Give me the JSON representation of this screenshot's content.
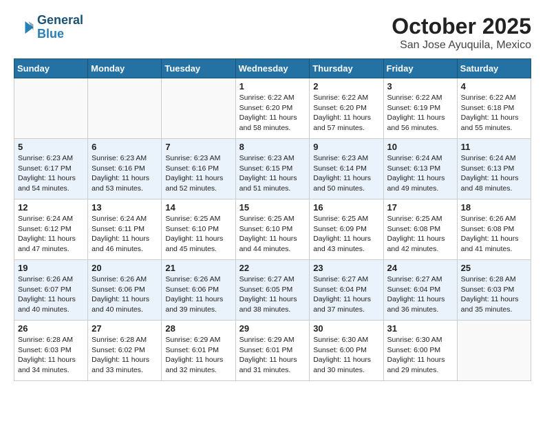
{
  "header": {
    "logo_line1": "General",
    "logo_line2": "Blue",
    "month": "October 2025",
    "location": "San Jose Ayuquila, Mexico"
  },
  "weekdays": [
    "Sunday",
    "Monday",
    "Tuesday",
    "Wednesday",
    "Thursday",
    "Friday",
    "Saturday"
  ],
  "weeks": [
    [
      {
        "day": "",
        "info": ""
      },
      {
        "day": "",
        "info": ""
      },
      {
        "day": "",
        "info": ""
      },
      {
        "day": "1",
        "info": "Sunrise: 6:22 AM\nSunset: 6:20 PM\nDaylight: 11 hours\nand 58 minutes."
      },
      {
        "day": "2",
        "info": "Sunrise: 6:22 AM\nSunset: 6:20 PM\nDaylight: 11 hours\nand 57 minutes."
      },
      {
        "day": "3",
        "info": "Sunrise: 6:22 AM\nSunset: 6:19 PM\nDaylight: 11 hours\nand 56 minutes."
      },
      {
        "day": "4",
        "info": "Sunrise: 6:22 AM\nSunset: 6:18 PM\nDaylight: 11 hours\nand 55 minutes."
      }
    ],
    [
      {
        "day": "5",
        "info": "Sunrise: 6:23 AM\nSunset: 6:17 PM\nDaylight: 11 hours\nand 54 minutes."
      },
      {
        "day": "6",
        "info": "Sunrise: 6:23 AM\nSunset: 6:16 PM\nDaylight: 11 hours\nand 53 minutes."
      },
      {
        "day": "7",
        "info": "Sunrise: 6:23 AM\nSunset: 6:16 PM\nDaylight: 11 hours\nand 52 minutes."
      },
      {
        "day": "8",
        "info": "Sunrise: 6:23 AM\nSunset: 6:15 PM\nDaylight: 11 hours\nand 51 minutes."
      },
      {
        "day": "9",
        "info": "Sunrise: 6:23 AM\nSunset: 6:14 PM\nDaylight: 11 hours\nand 50 minutes."
      },
      {
        "day": "10",
        "info": "Sunrise: 6:24 AM\nSunset: 6:13 PM\nDaylight: 11 hours\nand 49 minutes."
      },
      {
        "day": "11",
        "info": "Sunrise: 6:24 AM\nSunset: 6:13 PM\nDaylight: 11 hours\nand 48 minutes."
      }
    ],
    [
      {
        "day": "12",
        "info": "Sunrise: 6:24 AM\nSunset: 6:12 PM\nDaylight: 11 hours\nand 47 minutes."
      },
      {
        "day": "13",
        "info": "Sunrise: 6:24 AM\nSunset: 6:11 PM\nDaylight: 11 hours\nand 46 minutes."
      },
      {
        "day": "14",
        "info": "Sunrise: 6:25 AM\nSunset: 6:10 PM\nDaylight: 11 hours\nand 45 minutes."
      },
      {
        "day": "15",
        "info": "Sunrise: 6:25 AM\nSunset: 6:10 PM\nDaylight: 11 hours\nand 44 minutes."
      },
      {
        "day": "16",
        "info": "Sunrise: 6:25 AM\nSunset: 6:09 PM\nDaylight: 11 hours\nand 43 minutes."
      },
      {
        "day": "17",
        "info": "Sunrise: 6:25 AM\nSunset: 6:08 PM\nDaylight: 11 hours\nand 42 minutes."
      },
      {
        "day": "18",
        "info": "Sunrise: 6:26 AM\nSunset: 6:08 PM\nDaylight: 11 hours\nand 41 minutes."
      }
    ],
    [
      {
        "day": "19",
        "info": "Sunrise: 6:26 AM\nSunset: 6:07 PM\nDaylight: 11 hours\nand 40 minutes."
      },
      {
        "day": "20",
        "info": "Sunrise: 6:26 AM\nSunset: 6:06 PM\nDaylight: 11 hours\nand 40 minutes."
      },
      {
        "day": "21",
        "info": "Sunrise: 6:26 AM\nSunset: 6:06 PM\nDaylight: 11 hours\nand 39 minutes."
      },
      {
        "day": "22",
        "info": "Sunrise: 6:27 AM\nSunset: 6:05 PM\nDaylight: 11 hours\nand 38 minutes."
      },
      {
        "day": "23",
        "info": "Sunrise: 6:27 AM\nSunset: 6:04 PM\nDaylight: 11 hours\nand 37 minutes."
      },
      {
        "day": "24",
        "info": "Sunrise: 6:27 AM\nSunset: 6:04 PM\nDaylight: 11 hours\nand 36 minutes."
      },
      {
        "day": "25",
        "info": "Sunrise: 6:28 AM\nSunset: 6:03 PM\nDaylight: 11 hours\nand 35 minutes."
      }
    ],
    [
      {
        "day": "26",
        "info": "Sunrise: 6:28 AM\nSunset: 6:03 PM\nDaylight: 11 hours\nand 34 minutes."
      },
      {
        "day": "27",
        "info": "Sunrise: 6:28 AM\nSunset: 6:02 PM\nDaylight: 11 hours\nand 33 minutes."
      },
      {
        "day": "28",
        "info": "Sunrise: 6:29 AM\nSunset: 6:01 PM\nDaylight: 11 hours\nand 32 minutes."
      },
      {
        "day": "29",
        "info": "Sunrise: 6:29 AM\nSunset: 6:01 PM\nDaylight: 11 hours\nand 31 minutes."
      },
      {
        "day": "30",
        "info": "Sunrise: 6:30 AM\nSunset: 6:00 PM\nDaylight: 11 hours\nand 30 minutes."
      },
      {
        "day": "31",
        "info": "Sunrise: 6:30 AM\nSunset: 6:00 PM\nDaylight: 11 hours\nand 29 minutes."
      },
      {
        "day": "",
        "info": ""
      }
    ]
  ]
}
